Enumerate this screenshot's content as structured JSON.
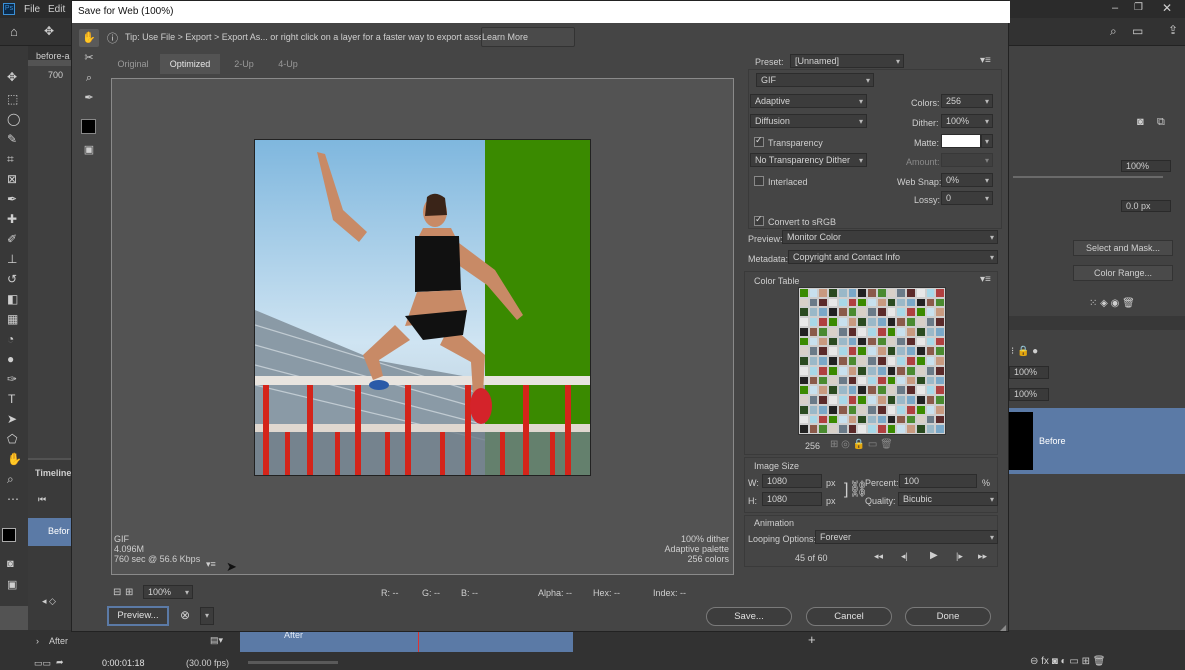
{
  "ps": {
    "menu": [
      "File",
      "Edit"
    ],
    "doc_tab": "before-a",
    "ruler_value": "700",
    "timeline_label": "Timeline",
    "layer_label_short": "Befor",
    "right_pct1": "100%",
    "right_px": "0.0 px",
    "select_mask": "Select and Mask...",
    "color_range": "Color Range...",
    "opacity1": "100%",
    "opacity2": "100%",
    "layer_before": "Before",
    "bottom_after": "After",
    "bottom_after2": "After",
    "timecode": "0:00:01:18",
    "fps": "(30.00 fps)"
  },
  "dialog": {
    "title": "Save for Web (100%)",
    "close": "✕",
    "tip": "Tip: Use File > Export > Export As...  or right click on a layer for a faster way to export assets",
    "learn_more": "Learn More",
    "tabs": [
      "Original",
      "Optimized",
      "2-Up",
      "4-Up"
    ],
    "info_left": [
      "GIF",
      "4.096M",
      "760 sec @ 56.6 Kbps"
    ],
    "info_right": [
      "100% dither",
      "Adaptive palette",
      "256 colors"
    ],
    "zoom": "100%",
    "readouts": {
      "r": "R: --",
      "g": "G: --",
      "b": "B: --",
      "alpha": "Alpha: --",
      "hex": "Hex: --",
      "index": "Index: --"
    },
    "preview_btn": "Preview...",
    "save_btn": "Save...",
    "cancel_btn": "Cancel",
    "done_btn": "Done"
  },
  "settings": {
    "preset_label": "Preset:",
    "preset_value": "[Unnamed]",
    "format": "GIF",
    "reduction": "Adaptive",
    "dither_algo": "Diffusion",
    "colors_label": "Colors:",
    "colors_value": "256",
    "dither_label": "Dither:",
    "dither_value": "100%",
    "transparency_label": "Transparency",
    "matte_label": "Matte:",
    "trans_dither": "No Transparency Dither",
    "amount_label": "Amount:",
    "interlaced_label": "Interlaced",
    "websnap_label": "Web Snap:",
    "websnap_value": "0%",
    "lossy_label": "Lossy:",
    "lossy_value": "0",
    "convert_srgb": "Convert to sRGB",
    "preview_label": "Preview:",
    "preview_value": "Monitor Color",
    "metadata_label": "Metadata:",
    "metadata_value": "Copyright and Contact Info",
    "color_table_label": "Color Table",
    "color_count": "256",
    "image_size_label": "Image Size",
    "w_label": "W:",
    "w_value": "1080",
    "h_label": "H:",
    "h_value": "1080",
    "px": "px",
    "percent_label": "Percent:",
    "percent_value": "100",
    "pct": "%",
    "quality_label": "Quality:",
    "quality_value": "Bicubic",
    "animation_label": "Animation",
    "looping_label": "Looping Options:",
    "looping_value": "Forever",
    "frame_counter": "45 of 60"
  },
  "colors": {
    "accent_blue": "#5b7aa6",
    "green": "#3a8a00"
  }
}
